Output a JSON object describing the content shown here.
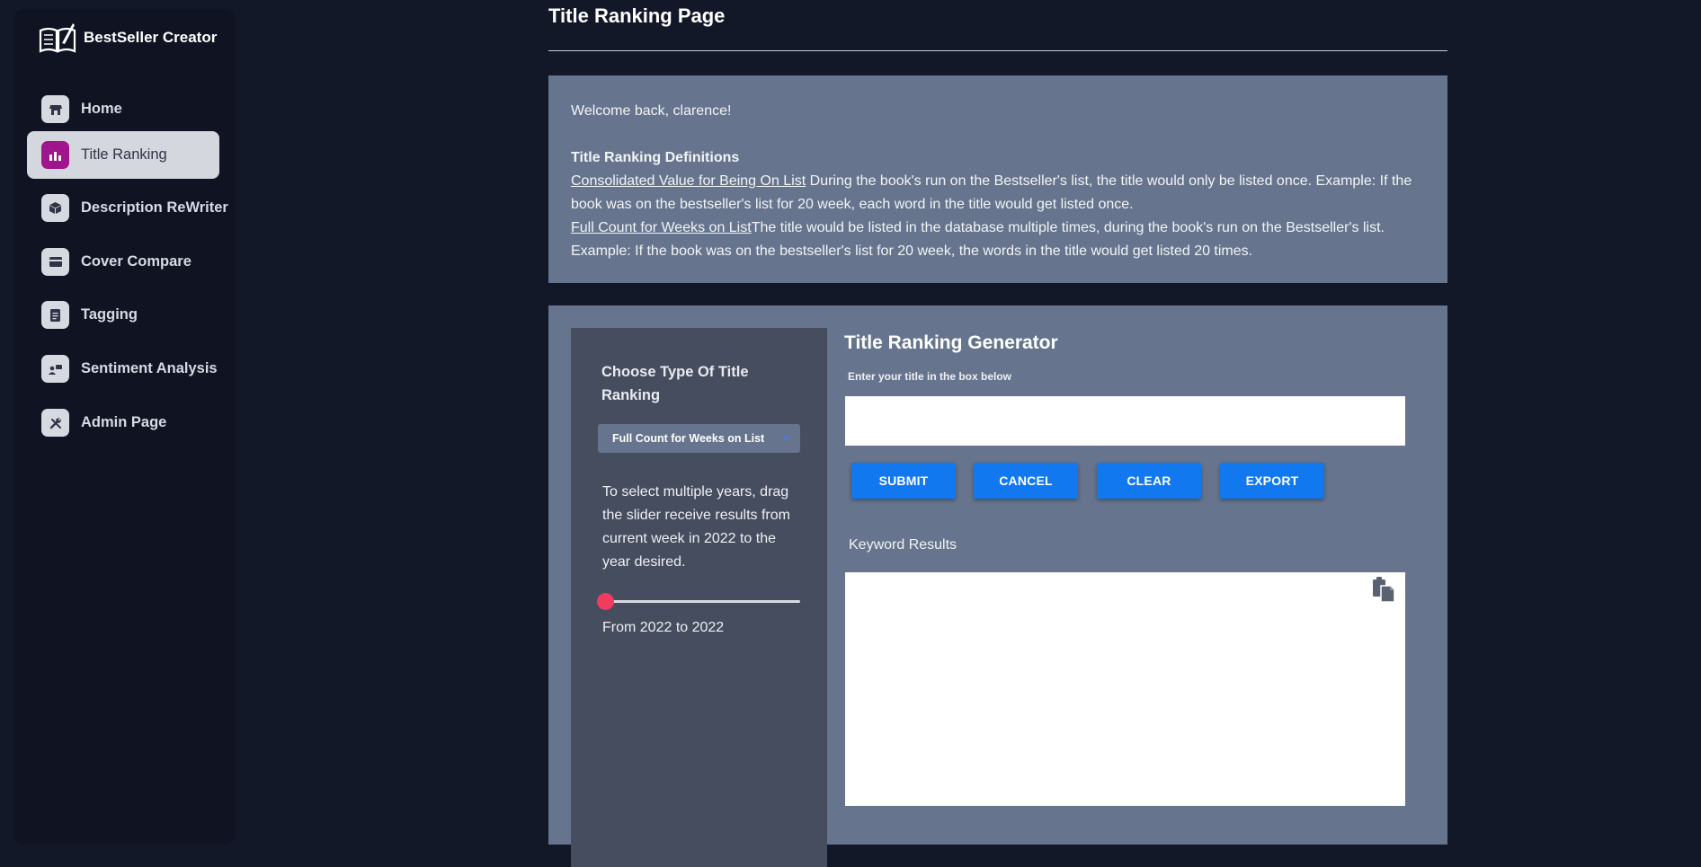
{
  "app": {
    "name": "BestSeller Creator",
    "logo_icon": "open-book-quill-icon"
  },
  "sidebar": {
    "items": [
      {
        "label": "Home",
        "icon": "store-icon",
        "active": false
      },
      {
        "label": "Title Ranking",
        "icon": "bar-chart-icon",
        "active": true
      },
      {
        "label": "Description ReWriter",
        "icon": "cube-icon",
        "active": false
      },
      {
        "label": "Cover Compare",
        "icon": "credit-card-icon",
        "active": false
      },
      {
        "label": "Tagging",
        "icon": "document-icon",
        "active": false
      },
      {
        "label": "Sentiment Analysis",
        "icon": "user-chat-icon",
        "active": false
      },
      {
        "label": "Admin Page",
        "icon": "tools-icon",
        "active": false
      }
    ]
  },
  "page": {
    "title": "Title Ranking Page"
  },
  "info": {
    "welcome": "Welcome back, clarence!",
    "definitions_heading": "Title Ranking Definitions",
    "def1_term": "Consolidated Value for Being On List",
    "def1_text": " During the book's run on the Bestseller's list, the title would only be listed once. Example: If the book was on the bestseller's list for 20 week, each word in the title would get listed once.",
    "def2_term": "Full Count for Weeks on List",
    "def2_text": "The title would be listed in the database multiple times, during the book's run on the Bestseller's list. Example: If the book was on the bestseller's list for 20 week, the words in the title would get listed 20 times."
  },
  "ranking_type": {
    "heading": "Choose Type Of Title Ranking",
    "selected": "Full Count for Weeks on List"
  },
  "slider": {
    "help": "To select multiple years, drag the slider receive results from current week in 2022 to the year desired.",
    "readout": "From 2022 to 2022",
    "value_fraction": 0.0
  },
  "generator": {
    "title": "Title Ranking Generator",
    "subtitle": "Enter your title in the box below",
    "input_value": "",
    "buttons": {
      "submit": "SUBMIT",
      "cancel": "CANCEL",
      "clear": "CLEAR",
      "export": "EXPORT"
    },
    "results_label": "Keyword Results",
    "results_value": "",
    "copy_icon": "clipboard-copy-icon"
  },
  "colors": {
    "background": "#131829",
    "sidebar": "#0f1322",
    "panel": "#66758d",
    "left_column": "#464d5e",
    "accent_active": "#a0148c",
    "button": "#1178ef",
    "slider_thumb": "#f33a5f"
  }
}
